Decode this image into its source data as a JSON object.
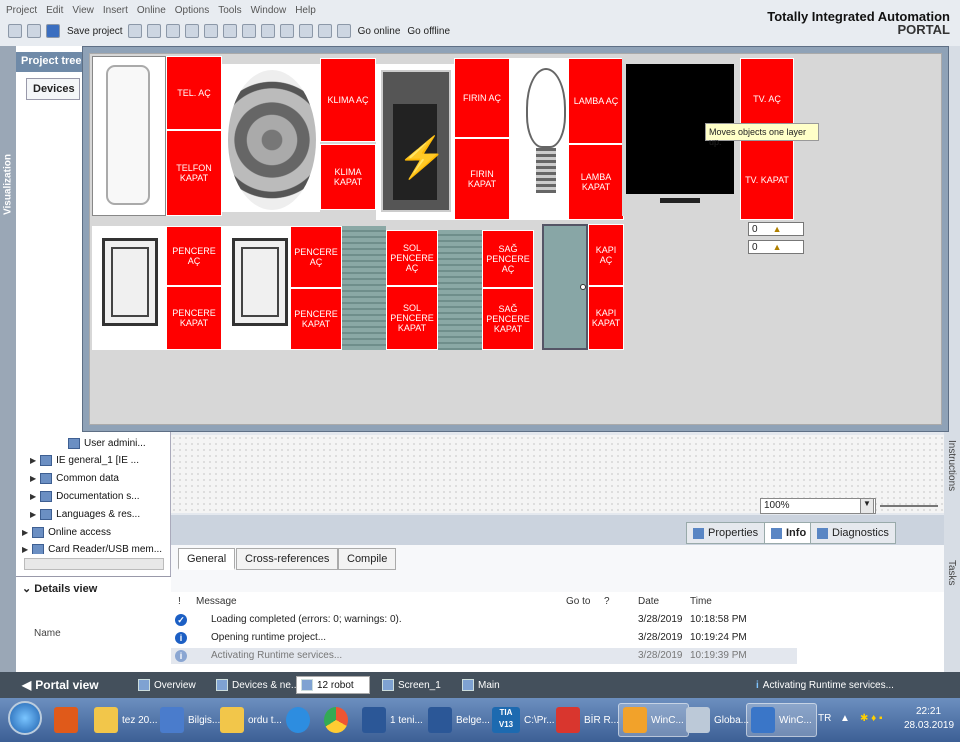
{
  "menu": [
    "Project",
    "Edit",
    "View",
    "Insert",
    "Online",
    "Options",
    "Tools",
    "Window",
    "Help"
  ],
  "toolbar": {
    "save_label": "Save project",
    "go_online": "Go online",
    "go_offline": "Go offline"
  },
  "brand": {
    "line1": "Totally Integrated Automation",
    "line2": "PORTAL"
  },
  "sidebar": {
    "vertical_tab": "Visualization"
  },
  "project_tree": {
    "title": "Project tree",
    "devices_tab": "Devices",
    "items": [
      "User admini...",
      "IE general_1 [IE ...",
      "Common data",
      "Documentation s...",
      "Languages & res...",
      "Online access",
      "Card Reader/USB mem..."
    ]
  },
  "details_view": {
    "title": "Details view",
    "name_col": "Name"
  },
  "popup": {
    "buttons": {
      "tel_on": "TEL. AÇ",
      "tel_off": "TELFON KAPAT",
      "klima_on": "KLIMA AÇ",
      "klima_off": "KLIMA KAPAT",
      "firin_on": "FIRIN AÇ",
      "firin_off": "FIRIN KAPAT",
      "lamba_on": "LAMBA AÇ",
      "lamba_off": "LAMBA KAPAT",
      "tv_on": "TV. AÇ",
      "tv_off": "TV. KAPAT",
      "pencere1_on": "PENCERE AÇ",
      "pencere1_off": "PENCERE KAPAT",
      "pencere2_on": "PENCERE AÇ",
      "pencere2_off": "PENCERE KAPAT",
      "sol_on": "SOL PENCERE AÇ",
      "sol_off": "SOL PENCERE KAPAT",
      "sag_on": "SAĞ PENCERE AÇ",
      "sag_off": "SAĞ PENCERE KAPAT",
      "kapi_on": "KAPI AÇ",
      "kapi_off": "KAPI KAPAT"
    },
    "io_fields": [
      {
        "value": "0"
      },
      {
        "value": "0"
      }
    ],
    "tooltip": "Moves objects one layer up."
  },
  "editor": {
    "zoom": "100%"
  },
  "right_strip": [
    "Instructions",
    "Tasks"
  ],
  "inspector": {
    "tabs": [
      "Properties",
      "Info",
      "Diagnostics"
    ],
    "active": "Info"
  },
  "info_tabs": [
    "General",
    "Cross-references",
    "Compile"
  ],
  "message_table": {
    "headers": [
      "!",
      "Message",
      "Go to",
      "?",
      "Date",
      "Time"
    ],
    "rows": [
      {
        "icon": "check-icon",
        "message": "Loading completed (errors: 0; warnings: 0).",
        "date": "3/28/2019",
        "time": "10:18:58 PM"
      },
      {
        "icon": "info-icon",
        "message": "Opening runtime project...",
        "date": "3/28/2019",
        "time": "10:19:24 PM"
      },
      {
        "icon": "info-icon",
        "message": "Activating Runtime services...",
        "date": "3/28/2019",
        "time": "10:19:39 PM"
      }
    ]
  },
  "portal_bar": {
    "portal_view": "Portal view",
    "tabs": [
      "Overview",
      "Devices & ne...",
      "12 robot",
      "Screen_1",
      "Main"
    ],
    "status": "Activating Runtime services..."
  },
  "taskbar": {
    "apps": [
      "tez 20...",
      "Bilgis...",
      "ordu t...",
      "1 teni...",
      "Belge...",
      "C:\\Pr...",
      "BİR R...",
      "WinC...",
      "Globa...",
      "WinC..."
    ],
    "tia_label": "TIA V13",
    "lang": "TR",
    "time": "22:21",
    "date": "28.03.2019"
  },
  "colors": {
    "button_red": "#ff0000",
    "tia_blue": "#3c5f95"
  }
}
